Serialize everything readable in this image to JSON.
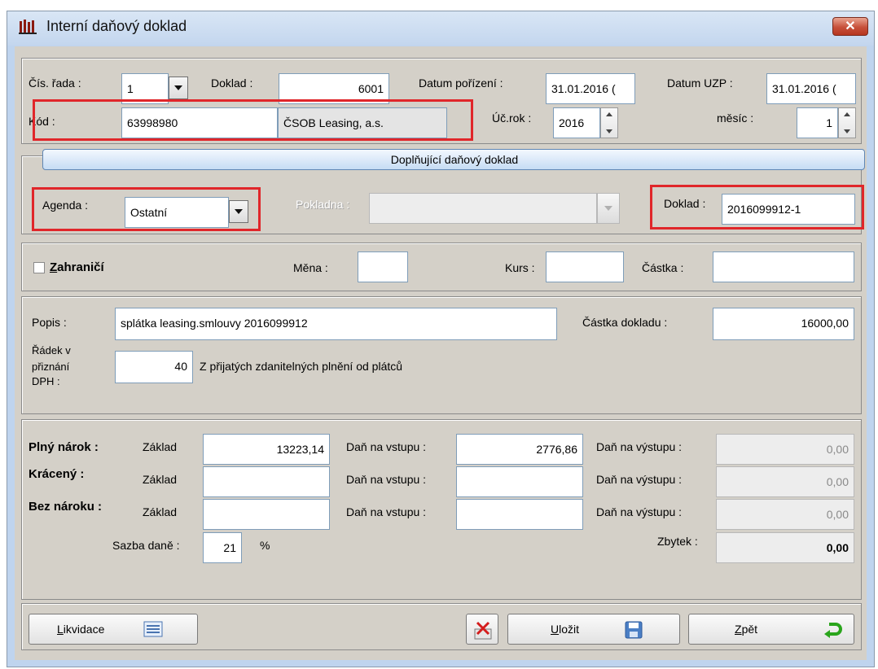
{
  "window": {
    "title": "Interní daňový doklad",
    "close_label": "✕"
  },
  "header": {
    "cis_rada": {
      "label": "Čís. řada :",
      "value": "1"
    },
    "doklad": {
      "label": "Doklad :",
      "value": "6001"
    },
    "datum_porizeni": {
      "label": "Datum pořízení :",
      "value": "31.01.2016 ("
    },
    "datum_uzp": {
      "label": "Datum UZP :",
      "value": "31.01.2016 ("
    },
    "kod": {
      "label": "Kód :",
      "value": "63998980",
      "name": "ČSOB Leasing, a.s."
    },
    "uc_rok": {
      "label": "Úč.rok :",
      "value": "2016"
    },
    "mesic": {
      "label": "měsíc :",
      "value": "1"
    }
  },
  "supplement": {
    "title": "Doplňující daňový doklad",
    "agenda": {
      "label": "Agenda :",
      "value": "Ostatní"
    },
    "pokladna": {
      "label": "Pokladna :",
      "value": ""
    },
    "doklad": {
      "label": "Doklad :",
      "value": "2016099912-1"
    }
  },
  "foreign": {
    "checkbox_label_prefix": "Z",
    "checkbox_label_rest": "ahraničí",
    "checked": false,
    "mena_label": "Měna :",
    "kurs_label": "Kurs :",
    "castka_label": "Částka :"
  },
  "description": {
    "popis_label": "Popis :",
    "popis_value": "splátka leasing.smlouvy 2016099912",
    "castka_dokladu_label": "Částka dokladu :",
    "castka_dokladu_value": "16000,00",
    "radek_label_1": "Řádek v",
    "radek_label_2": "přiznání",
    "radek_label_3": "DPH :",
    "radek_value": "40",
    "radek_desc": "Z přijatých zdanitelných plnění od plátců"
  },
  "tax": {
    "zaklad_label": "Základ",
    "dan_vstup_label": "Daň na vstupu :",
    "dan_vystup_label": "Daň na výstupu :",
    "rows": [
      {
        "label": "Plný nárok :",
        "zaklad": "13223,14",
        "vstup": "2776,86",
        "vystup": "0,00"
      },
      {
        "label": "Krácený :",
        "zaklad": "",
        "vstup": "",
        "vystup": "0,00"
      },
      {
        "label": "Bez nároku :",
        "zaklad": "",
        "vstup": "",
        "vystup": "0,00"
      }
    ],
    "sazba_label": "Sazba daně :",
    "sazba_value": "21",
    "percent": "%",
    "zbytek_label": "Zbytek :",
    "zbytek_value": "0,00"
  },
  "footer": {
    "likvidace_first": "L",
    "likvidace_rest": "ikvidace",
    "ulozit_first": "U",
    "ulozit_rest": "ložit",
    "zpet_first": "Z",
    "zpet_rest": "pět"
  },
  "colors": {
    "highlight": "#e0262a",
    "title_bar": "#c3d6ee",
    "panel": "#d4d0c8"
  }
}
